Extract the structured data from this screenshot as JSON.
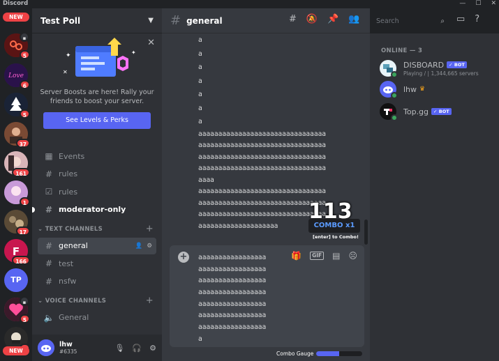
{
  "window": {
    "brand": "Discord",
    "controls": [
      "—",
      "☐",
      "✕"
    ]
  },
  "rail": {
    "new_top": "NEW",
    "new_bottom": "NEW",
    "badges": [
      "5",
      "6",
      "5",
      "37",
      "161",
      "1",
      "17",
      "166",
      "5",
      "1"
    ],
    "tp_label": "TP"
  },
  "server": {
    "name": "Test Poll"
  },
  "boost": {
    "text": "Server Boosts are here! Rally your friends to boost your server.",
    "button": "See Levels & Perks"
  },
  "channels": {
    "top": [
      {
        "label": "Events",
        "icon": "calendar-icon"
      },
      {
        "label": "rules",
        "icon": "hash-icon"
      },
      {
        "label": "rules",
        "icon": "checkbox-icon"
      },
      {
        "label": "moderator-only",
        "icon": "hash-icon"
      }
    ],
    "text_category": "TEXT CHANNELS",
    "text": [
      "general",
      "test",
      "nsfw"
    ],
    "voice_category": "VOICE CHANNELS",
    "voice": [
      "General"
    ]
  },
  "user": {
    "name": "lhw",
    "tag": "#6335"
  },
  "chat": {
    "channel": "general",
    "lines_short": [
      "a",
      "a",
      "a",
      "a",
      "a",
      "a",
      "a"
    ],
    "lines_long": [
      "aaaaaaaaaaaaaaaaaaaaaaaaaaaaaaaa",
      "aaaaaaaaaaaaaaaaaaaaaaaaaaaaaaaa",
      "aaaaaaaaaaaaaaaaaaaaaaaaaaaaaaaa",
      "aaaaaaaaaaaaaaaaaaaaaaaaaaaaaaaa",
      "aaaa",
      "aaaaaaaaaaaaaaaaaaaaaaaaaaaaaaaa",
      "aaaaaaaaaaaaaaaaaaaaaaaaaaaaaaaa",
      "aaaaaaaaaaaaaaaaaaaaaaaaaaaaaaaa",
      "aaaaaaaaaaaaaaaaaaaa"
    ],
    "composer_lines": [
      "aaaaaaaaaaaaaaaaa",
      "aaaaaaaaaaaaaaaaa",
      "aaaaaaaaaaaaaaaaa",
      "aaaaaaaaaaaaaaaaa",
      "aaaaaaaaaaaaaaaaa",
      "aaaaaaaaaaaaaaaaa",
      "aaaaaaaaaaaaaaaaa",
      "a"
    ]
  },
  "combo": {
    "count": "113",
    "label": "COMBO x1",
    "hint": "[enter] to Combo!"
  },
  "gauge": {
    "label": "Combo Gauge",
    "level": 0.5
  },
  "search": {
    "placeholder": "Search"
  },
  "members": {
    "heading": "ONLINE — 3",
    "list": [
      {
        "name": "DISBOARD",
        "badge": "✓ BOT",
        "sub": "Playing / | 1,344,665 servers"
      },
      {
        "name": "lhw",
        "badge": "",
        "sub": ""
      },
      {
        "name": "Top.gg",
        "badge": "✓ BOT",
        "sub": ""
      }
    ]
  }
}
